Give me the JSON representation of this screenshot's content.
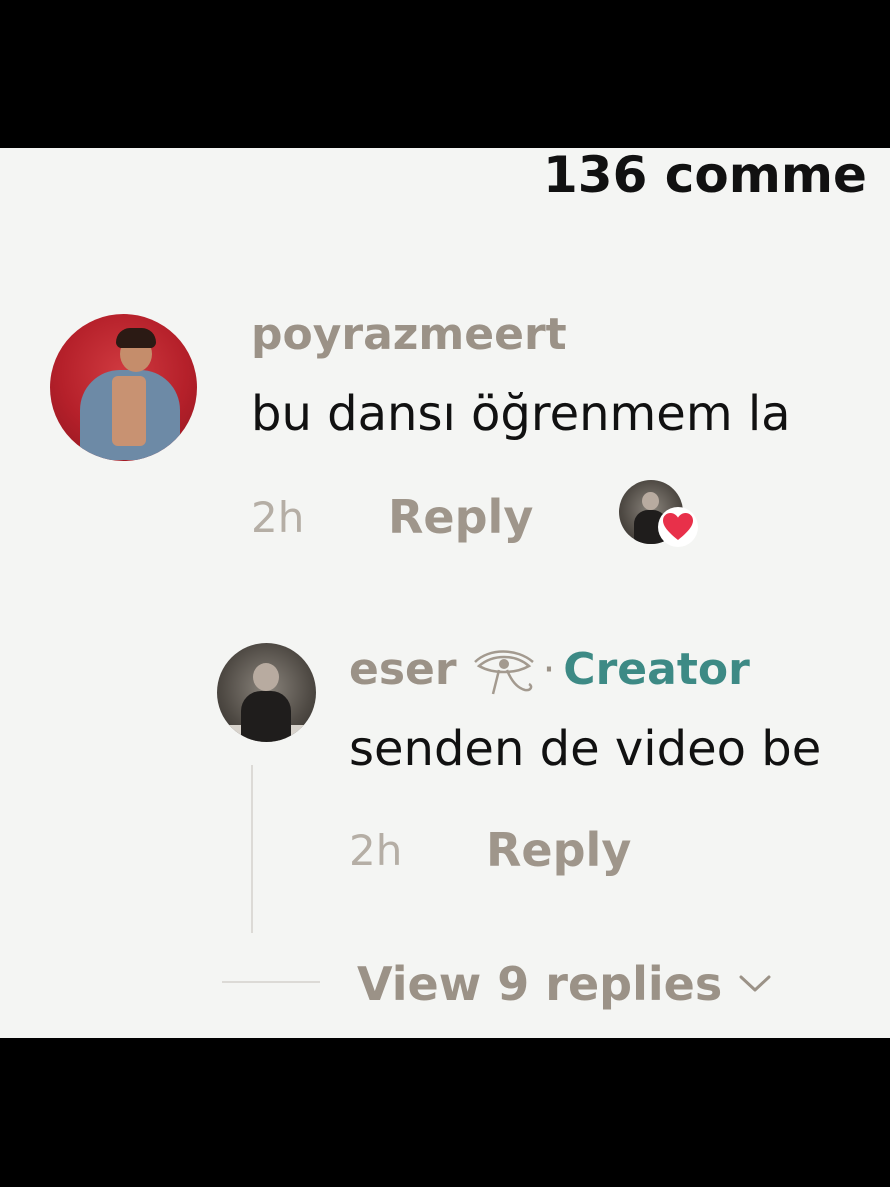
{
  "header": {
    "comment_count": "136 comme"
  },
  "comments": [
    {
      "username": "poyrazmeert",
      "text": "bu dansı öğrenmem la",
      "time": "2h",
      "reply_label": "Reply",
      "liked_by_creator": true
    }
  ],
  "reply": {
    "username": "eser",
    "separator": "·",
    "badge": "Creator",
    "text": "senden de video be",
    "time": "2h",
    "reply_label": "Reply"
  },
  "view_replies": {
    "label": "View 9 replies"
  },
  "colors": {
    "username": "#9b9287",
    "creator_badge": "#3d8a85",
    "heart": "#e8304a",
    "panel_bg": "#f4f5f3"
  },
  "icons": {
    "creator_emblem": "eye-of-horus-icon",
    "like": "heart-icon",
    "expand": "chevron-down-icon"
  }
}
